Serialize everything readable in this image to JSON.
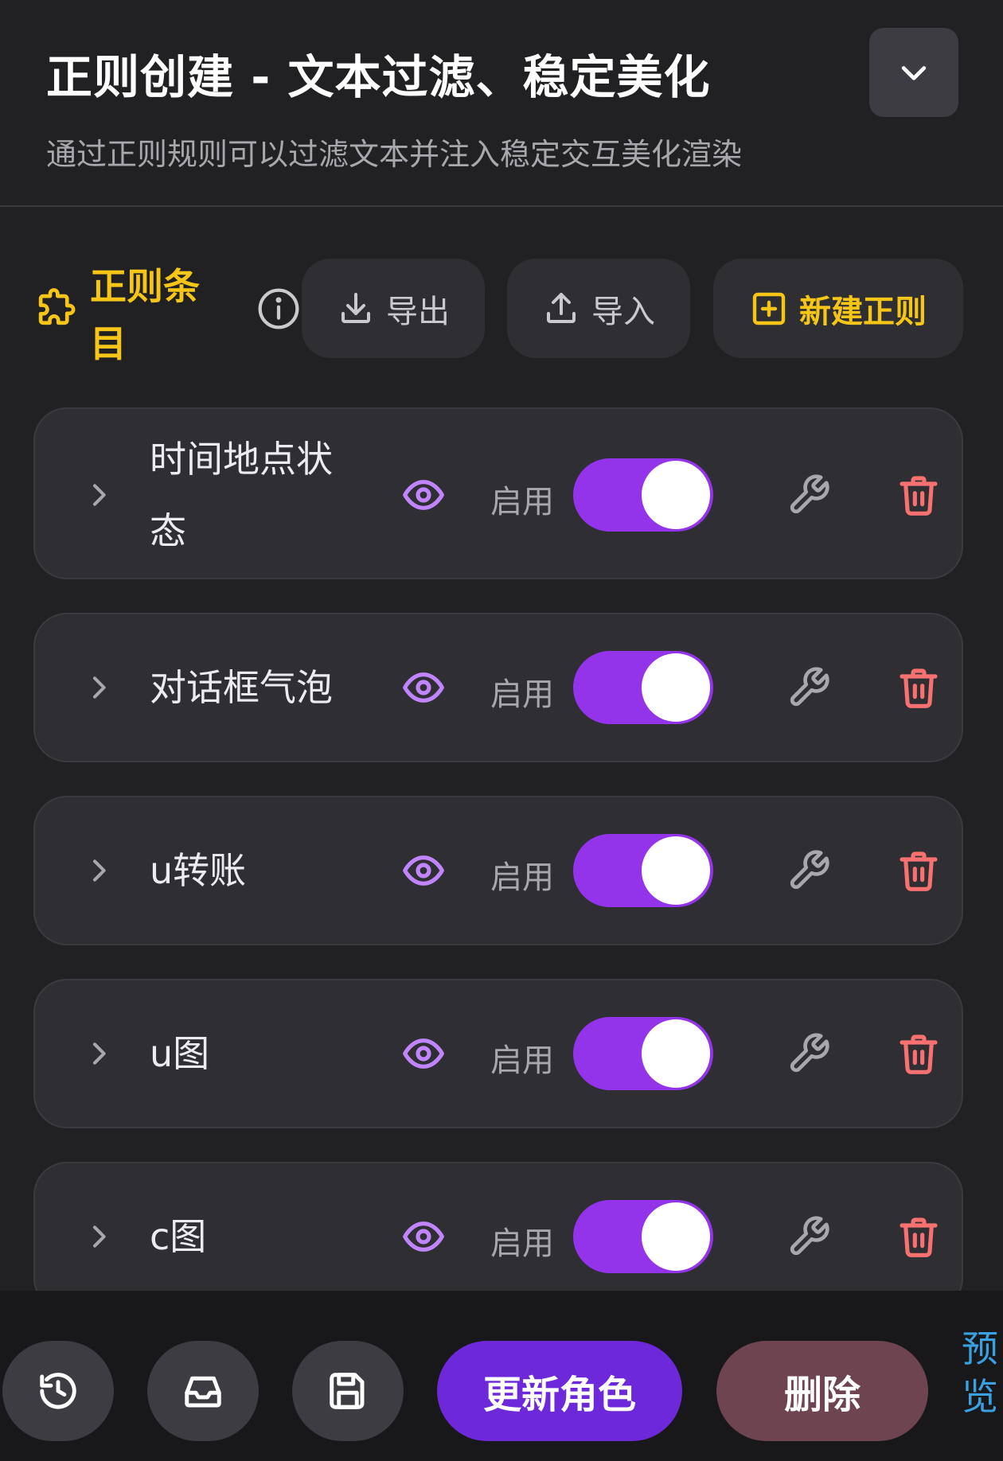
{
  "header": {
    "title": "正则创建 - 文本过滤、稳定美化",
    "subtitle": "通过正则规则可以过滤文本并注入稳定交互美化渲染"
  },
  "section": {
    "title": "正则条目",
    "export_label": "导出",
    "import_label": "导入",
    "new_label": "新建正则"
  },
  "rules": [
    {
      "name": "时间地点状态",
      "status_label": "启用",
      "enabled": true
    },
    {
      "name": "对话框气泡",
      "status_label": "启用",
      "enabled": true
    },
    {
      "name": "u转账",
      "status_label": "启用",
      "enabled": true
    },
    {
      "name": "u图",
      "status_label": "启用",
      "enabled": true
    },
    {
      "name": "c图",
      "status_label": "启用",
      "enabled": true
    }
  ],
  "bottom_bar": {
    "update_label": "更新角色",
    "delete_label": "删除",
    "preview_label": "预览"
  },
  "colors": {
    "background": "#212124",
    "accent_yellow": "#f5c518",
    "toggle_purple": "#9333ea",
    "eye_purple": "#c084fc",
    "trash_red": "#f87171",
    "update_button": "#6d28d9",
    "delete_button": "#6e4450",
    "preview_link": "#3aa0e0"
  },
  "icons": [
    "chevron-down-icon",
    "puzzle-icon",
    "info-icon",
    "download-icon",
    "upload-icon",
    "plus-square-icon",
    "chevron-right-icon",
    "eye-icon",
    "wrench-icon",
    "trash-icon",
    "history-icon",
    "inbox-icon",
    "save-icon"
  ]
}
